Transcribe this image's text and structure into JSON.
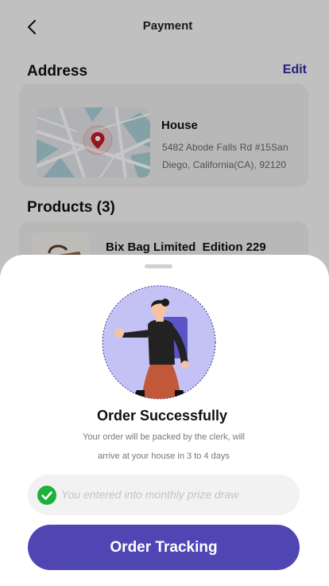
{
  "header": {
    "title": "Payment"
  },
  "address": {
    "section_title": "Address",
    "edit_label": "Edit",
    "label": "House",
    "line1": "5482 Abode Falls Rd #15San",
    "line2": "Diego, California(CA), 92120"
  },
  "products": {
    "section_title": "Products (3)",
    "items": [
      {
        "name": "Bix Bag Limited  Edition 229"
      }
    ]
  },
  "sheet": {
    "title": "Order Successfully",
    "message_line1": "Your order will be packed by the clerk, will",
    "message_line2": "arrive at your house in 3 to 4 days",
    "prize_text": "You entered into monthly prize draw",
    "button_label": "Order Tracking"
  },
  "colors": {
    "accent": "#4f46b4",
    "edit_link": "#2f2aa5",
    "success_check": "#1bb13a",
    "illustration_bg": "#c4c2f5"
  },
  "icons": [
    "back-arrow-icon",
    "location-pin-icon",
    "check-circle-icon"
  ]
}
